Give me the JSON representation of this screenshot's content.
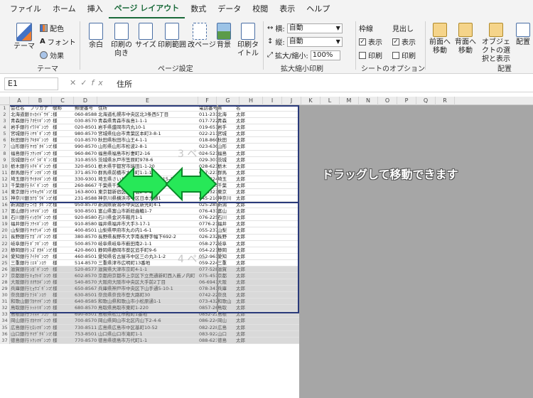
{
  "menu": {
    "tabs": [
      "ファイル",
      "ホーム",
      "挿入",
      "ページ レイアウト",
      "数式",
      "データ",
      "校閲",
      "表示",
      "ヘルプ"
    ]
  },
  "ribbon": {
    "theme_group": {
      "label": "テーマ",
      "theme_button": "テーマ",
      "colors": "配色",
      "fonts": "フォント",
      "effects": "効果"
    },
    "pagesetup_group": {
      "label": "ページ設定",
      "margins": "余白",
      "orientation": "印刷の向き",
      "size": "サイズ",
      "print_area": "印刷範囲",
      "breaks": "改ページ",
      "background": "背景",
      "print_titles": "印刷タイトル"
    },
    "scale_group": {
      "label": "拡大縮小印刷",
      "width_label": "横:",
      "width_value": "自動",
      "height_label": "縦:",
      "height_value": "自動",
      "scale_label": "拡大/縮小:",
      "scale_value": "100%"
    },
    "sheet_options_group": {
      "label": "シートのオプション",
      "gridlines": "枠線",
      "headings": "見出し",
      "view": "表示",
      "print": "印刷"
    },
    "arrange_group": {
      "label": "配置",
      "bring_forward": "前面へ移動",
      "send_backward": "背面へ移動",
      "selection_pane": "オブジェクトの選択と表示",
      "align": "配置"
    }
  },
  "formula_bar": {
    "name_box": "E1",
    "formula": "住所"
  },
  "columns": [
    "A",
    "B",
    "C",
    "D",
    "E",
    "F",
    "G",
    "H",
    "I",
    "J",
    "K",
    "L",
    "M",
    "N",
    "O",
    "P",
    "Q",
    "R"
  ],
  "header_row": [
    "会社名",
    "フリガナ",
    "敬称",
    "郵便番号",
    "住所",
    "電話番号",
    "県",
    "名"
  ],
  "rows": [
    [
      "北海道銀行",
      "ﾎｯｶｲﾄﾞｳｷﾞﾝｺｳ",
      "様",
      "060-8588",
      "北海道札幌市中央区北3条西5丁目",
      "011-231-1111",
      "北海",
      "太郎"
    ],
    [
      "青森銀行",
      "ｱｵﾓﾘｷﾞﾝｺｳ",
      "様",
      "030-8570",
      "青森県青森市長島1-1-1",
      "017-722-1111",
      "青森",
      "太郎"
    ],
    [
      "岩手銀行",
      "ｲﾜﾃｷﾞﾝｺｳ",
      "様",
      "020-8501",
      "岩手県盛岡市内丸10-1",
      "019-651-3111",
      "岩手",
      "太郎"
    ],
    [
      "宮城銀行",
      "ﾐﾔｷﾞｷﾞﾝｺｳ",
      "様",
      "980-8570",
      "宮城県仙台市青葉区本町3-8-1",
      "022-211-2111",
      "宮城",
      "太郎"
    ],
    [
      "秋田銀行",
      "ｱｷﾀｷﾞﾝｺｳ",
      "様",
      "010-8570",
      "秋田県秋田市山王4-1-1",
      "018-860-1111",
      "秋田",
      "太郎"
    ],
    [
      "山形銀行",
      "ﾔﾏｶﾞﾀｷﾞﾝｺｳ",
      "様",
      "990-8570",
      "山形県山形市松波2-8-1",
      "023-630-2211",
      "山形",
      "太郎"
    ],
    [
      "福島銀行",
      "ﾌｸｼﾏｷﾞﾝｺｳ",
      "様",
      "960-8670",
      "福島県福島市杉妻町2-16",
      "024-521-1111",
      "福島",
      "太郎"
    ],
    [
      "茨城銀行",
      "ｲﾊﾞﾗｷﾞｷﾞﾝｺｳ",
      "様",
      "310-8555",
      "茨城県水戸市笠原町978-6",
      "029-301-1111",
      "茨城",
      "太郎"
    ],
    [
      "栃木銀行",
      "ﾄﾁｷﾞｷﾞﾝｺｳ",
      "様",
      "320-8501",
      "栃木県宇都宮市塙田1-1-20",
      "028-623-2323",
      "栃木",
      "太郎"
    ],
    [
      "群馬銀行",
      "ｸﾞﾝﾏｷﾞﾝｺｳ",
      "様",
      "371-8570",
      "群馬県前橋市大手町1-1-1",
      "027-223-1111",
      "群馬",
      "太郎"
    ],
    [
      "埼玉銀行",
      "ｻｲﾀﾏｷﾞﾝｺｳ",
      "様",
      "330-9301",
      "埼玉県さいたま市浦和区高砂3-15-1",
      "048-824-2111",
      "埼玉",
      "太郎"
    ],
    [
      "千葉銀行",
      "ﾁﾊﾞｷﾞﾝｺｳ",
      "様",
      "260-8667",
      "千葉県千葉市中央区市場町1-1",
      "043-223-2110",
      "千葉",
      "太郎"
    ],
    [
      "東京銀行",
      "ﾄｳｷｮｳｷﾞﾝｺｳ",
      "様",
      "163-8001",
      "東京都新宿区西新宿2-8-1",
      "03-5321-1111",
      "東京",
      "太郎"
    ],
    [
      "神奈川銀行",
      "ｶﾅｶﾞﾜｷﾞﾝｺｳ",
      "様",
      "231-8588",
      "神奈川県横浜市中区日本大通1",
      "045-210-1111",
      "神奈川",
      "太郎"
    ],
    [
      "新潟銀行",
      "ﾆｲｶﾞﾀｷﾞﾝｺｳ",
      "様",
      "950-8570",
      "新潟県新潟市中央区新光町4-1",
      "025-285-5511",
      "新潟",
      "太郎"
    ],
    [
      "富山銀行",
      "ﾄﾔﾏｷﾞﾝｺｳ",
      "様",
      "930-8501",
      "富山県富山市新総曲輪1-7",
      "076-431-4111",
      "富山",
      "太郎"
    ],
    [
      "石川銀行",
      "ｲｼｶﾜｷﾞﾝｺｳ",
      "様",
      "920-8580",
      "石川県金沢市鞍月1-1",
      "076-225-1111",
      "石川",
      "太郎"
    ],
    [
      "福井銀行",
      "ﾌｸｲｷﾞﾝｺｳ",
      "様",
      "910-8580",
      "福井県福井市大手3-17-1",
      "0776-21-1111",
      "福井",
      "太郎"
    ],
    [
      "山梨銀行",
      "ﾔﾏﾅｼｷﾞﾝｺｳ",
      "様",
      "400-8501",
      "山梨県甲府市丸の内1-6-1",
      "055-237-1111",
      "山梨",
      "太郎"
    ],
    [
      "長野銀行",
      "ﾅｶﾞﾉｷﾞﾝｺｳ",
      "様",
      "380-8570",
      "長野県長野市大字南長野字幅下692-2",
      "026-232-0111",
      "長野",
      "太郎"
    ],
    [
      "岐阜銀行",
      "ｷﾞﾌｷﾞﾝｺｳ",
      "様",
      "500-8570",
      "岐阜県岐阜市薮田南2-1-1",
      "058-272-1111",
      "岐阜",
      "太郎"
    ],
    [
      "静岡銀行",
      "ｼｽﾞｵｶｷﾞﾝｺｳ",
      "様",
      "420-8601",
      "静岡県静岡市葵区追手町9-6",
      "054-221-2455",
      "静岡",
      "太郎"
    ],
    [
      "愛知銀行",
      "ｱｲﾁｷﾞﾝｺｳ",
      "様",
      "460-8501",
      "愛知県名古屋市中区三の丸3-1-2",
      "052-961-2111",
      "愛知",
      "太郎"
    ],
    [
      "三重銀行",
      "ﾐｴｷﾞﾝｺｳ",
      "様",
      "514-8570",
      "三重県津市広明町13番地",
      "059-224-3070",
      "三重",
      "太郎"
    ],
    [
      "滋賀銀行",
      "ｼｶﾞｷﾞﾝｺｳ",
      "様",
      "520-8577",
      "滋賀県大津市京町4-1-1",
      "077-528-3993",
      "滋賀",
      "太郎"
    ],
    [
      "京都銀行",
      "ｷｮｳﾄｷﾞﾝｺｳ",
      "様",
      "602-8570",
      "京都府京都市上京区下立売通新町西入薮ノ内町",
      "075-451-8111",
      "京都",
      "太郎"
    ],
    [
      "大阪銀行",
      "ｵｵｻｶｷﾞﾝｺｳ",
      "様",
      "540-8570",
      "大阪府大阪市中央区大手前2丁目",
      "06-6941-0351",
      "大阪",
      "太郎"
    ],
    [
      "兵庫銀行",
      "ﾋｮｳｺﾞｷﾞﾝｺｳ",
      "様",
      "650-8567",
      "兵庫県神戸市中央区下山手通5-10-1",
      "078-341-7711",
      "兵庫",
      "太郎"
    ],
    [
      "奈良銀行",
      "ﾅﾗｷﾞﾝｺｳ",
      "様",
      "630-8501",
      "奈良県奈良市登大路町30",
      "0742-22-1101",
      "奈良",
      "太郎"
    ],
    [
      "和歌山銀行",
      "ﾜｶﾔﾏｷﾞﾝｺｳ",
      "様",
      "640-8585",
      "和歌山県和歌山市小松原通1-1",
      "073-432-4111",
      "和歌山",
      "太郎"
    ],
    [
      "鳥取銀行",
      "ﾄｯﾄﾘｷﾞﾝｺｳ",
      "様",
      "680-8570",
      "鳥取県鳥取市東町1-220",
      "0857-26-7111",
      "鳥取",
      "太郎"
    ],
    [
      "島根銀行",
      "ｼﾏﾈｷﾞﾝｺｳ",
      "様",
      "690-8501",
      "島根県松江市殿町1番地",
      "0852-22-5111",
      "島根",
      "太郎"
    ],
    [
      "岡山銀行",
      "ｵｶﾔﾏｷﾞﾝｺｳ",
      "様",
      "700-8570",
      "岡山県岡山市北区内山下2-4-6",
      "086-224-2111",
      "岡山",
      "太郎"
    ],
    [
      "広島銀行",
      "ﾋﾛｼﾏｷﾞﾝｺｳ",
      "様",
      "730-8511",
      "広島県広島市中区基町10-52",
      "082-228-2111",
      "広島",
      "太郎"
    ],
    [
      "山口銀行",
      "ﾔﾏｸﾞﾁｷﾞﾝｺｳ",
      "様",
      "753-8501",
      "山口県山口市滝町1-1",
      "083-922-3111",
      "山口",
      "太郎"
    ],
    [
      "徳島銀行",
      "ﾄｸｼﾏｷﾞﾝｺｳ",
      "様",
      "770-8570",
      "徳島県徳島市万代町1-1",
      "088-621-2500",
      "徳島",
      "太郎"
    ]
  ],
  "watermarks": {
    "page3": "3 ペー",
    "page4": "4 ペー"
  },
  "note": "ドラッグして移動できます"
}
